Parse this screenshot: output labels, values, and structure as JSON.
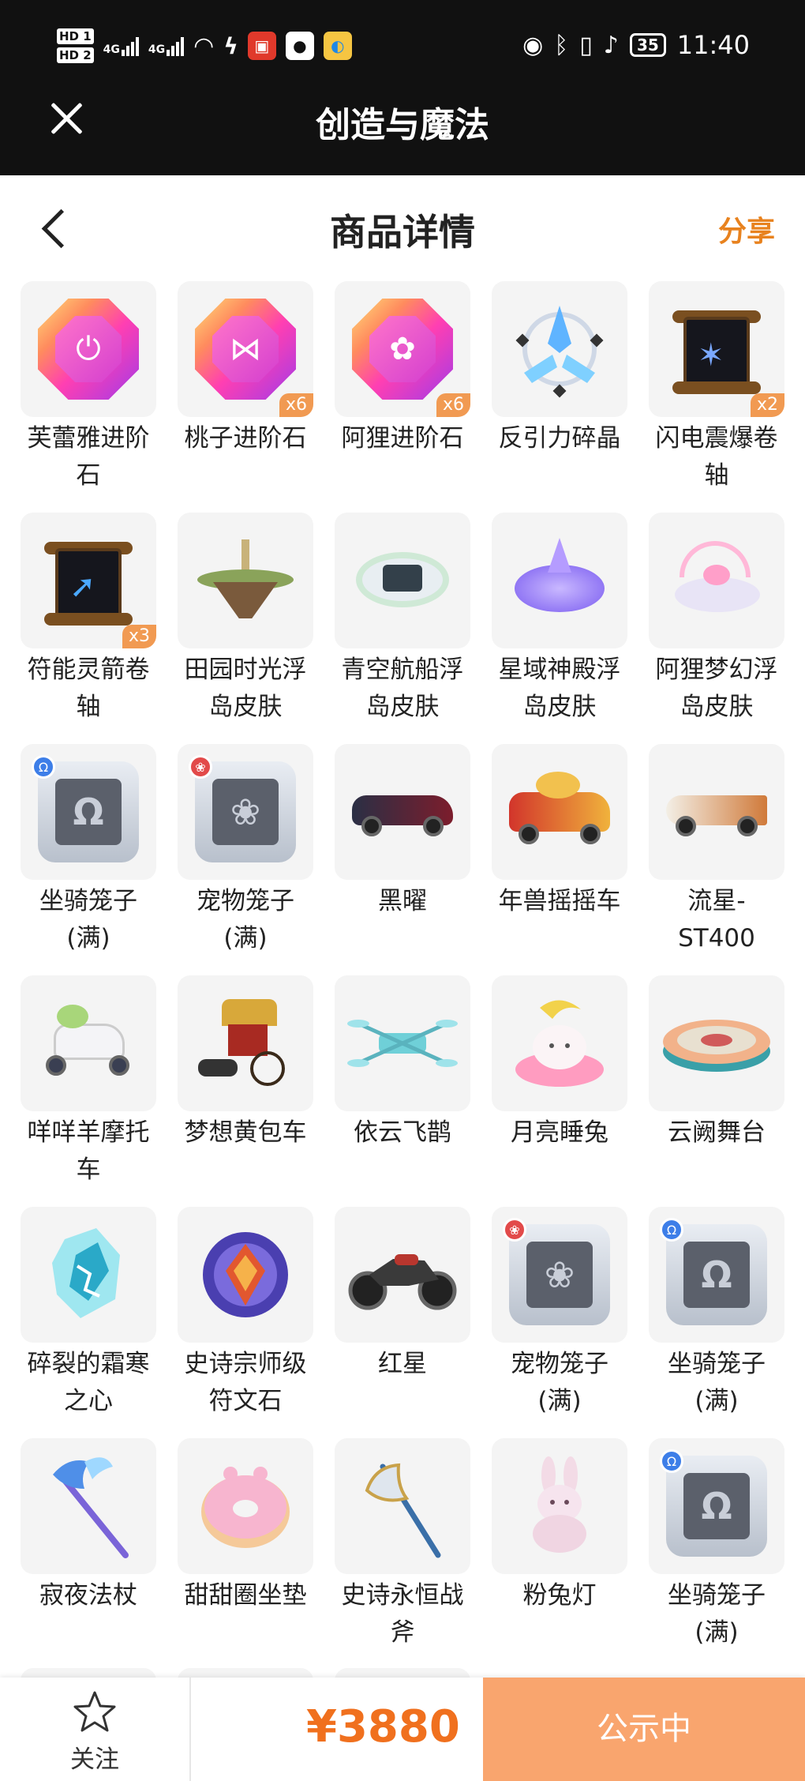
{
  "status_bar": {
    "hd1": "HD 1",
    "hd2": "HD 2",
    "net1": "4G",
    "net2": "4G",
    "battery": "35",
    "time": "11:40"
  },
  "app_bar": {
    "title": "创造与魔法"
  },
  "page_header": {
    "title": "商品详情",
    "share": "分享"
  },
  "items": [
    {
      "name": "芙蕾雅进阶石",
      "badge": ""
    },
    {
      "name": "桃子进阶石",
      "badge": "x6"
    },
    {
      "name": "阿狸进阶石",
      "badge": "x6"
    },
    {
      "name": "反引力碎晶",
      "badge": ""
    },
    {
      "name": "闪电震爆卷轴",
      "badge": "x2"
    },
    {
      "name": "符能灵箭卷轴",
      "badge": "x3"
    },
    {
      "name": "田园时光浮岛皮肤",
      "badge": ""
    },
    {
      "name": "青空航船浮岛皮肤",
      "badge": ""
    },
    {
      "name": "星域神殿浮岛皮肤",
      "badge": ""
    },
    {
      "name": "阿狸梦幻浮岛皮肤",
      "badge": ""
    },
    {
      "name": "坐骑笼子(满)",
      "badge": ""
    },
    {
      "name": "宠物笼子(满)",
      "badge": ""
    },
    {
      "name": "黑曜",
      "badge": ""
    },
    {
      "name": "年兽摇摇车",
      "badge": ""
    },
    {
      "name": "流星-ST400",
      "badge": ""
    },
    {
      "name": "咩咩羊摩托车",
      "badge": ""
    },
    {
      "name": "梦想黄包车",
      "badge": ""
    },
    {
      "name": "依云飞鹊",
      "badge": ""
    },
    {
      "name": "月亮睡兔",
      "badge": ""
    },
    {
      "name": "云阙舞台",
      "badge": ""
    },
    {
      "name": "碎裂的霜寒之心",
      "badge": ""
    },
    {
      "name": "史诗宗师级符文石",
      "badge": ""
    },
    {
      "name": "红星",
      "badge": ""
    },
    {
      "name": "宠物笼子(满)",
      "badge": ""
    },
    {
      "name": "坐骑笼子(满)",
      "badge": ""
    },
    {
      "name": "寂夜法杖",
      "badge": ""
    },
    {
      "name": "甜甜圈坐垫",
      "badge": ""
    },
    {
      "name": "史诗永恒战斧",
      "badge": ""
    },
    {
      "name": "粉兔灯",
      "badge": ""
    },
    {
      "name": "坐骑笼子(满)",
      "badge": ""
    }
  ],
  "bottom_bar": {
    "follow_label": "关注",
    "price": "¥3880",
    "cta_label": "公示中"
  },
  "colors": {
    "accent": "#f0701e",
    "cta": "#f9a56e",
    "share": "#e8821e"
  }
}
